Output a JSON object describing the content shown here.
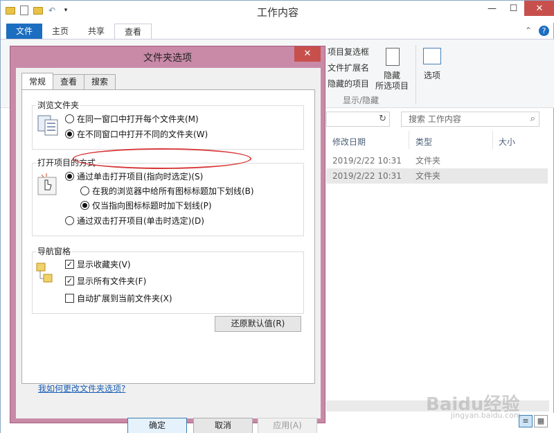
{
  "window": {
    "title": "工作内容",
    "minimize": "—",
    "maximize": "☐",
    "close": "✕"
  },
  "ribbon": {
    "tabs": [
      "文件",
      "主页",
      "共享",
      "查看"
    ],
    "options_label": "选项",
    "hide_label_1": "隐藏",
    "hide_label_2": "所选项目",
    "checkbox_items": [
      "项目复选框",
      "文件扩展名",
      "隐藏的项目"
    ],
    "group_label": "显示/隐藏",
    "help": "?",
    "expand": "⌃"
  },
  "nav": {
    "search_placeholder": "搜索 工作内容",
    "refresh": "↻",
    "search_icon": "⌕"
  },
  "columns": [
    "修改日期",
    "类型",
    "大小"
  ],
  "rows": [
    {
      "date": "2019/2/22 10:31",
      "type": "文件夹"
    },
    {
      "date": "2019/2/22 10:31",
      "type": "文件夹"
    }
  ],
  "dialog": {
    "title": "文件夹选项",
    "close": "✕",
    "tabs": [
      "常规",
      "查看",
      "搜索"
    ],
    "browse": {
      "label": "浏览文件夹",
      "opt1": "在同一窗口中打开每个文件夹(M)",
      "opt2": "在不同窗口中打开不同的文件夹(W)"
    },
    "click": {
      "label": "打开项目的方式",
      "single": "通过单击打开项目(指向时选定)(S)",
      "sub1": "在我的浏览器中给所有图标标题加下划线(B)",
      "sub2": "仅当指向图标标题时加下划线(P)",
      "double": "通过双击打开项目(单击时选定)(D)"
    },
    "navpane": {
      "label": "导航窗格",
      "fav": "显示收藏夹(V)",
      "all": "显示所有文件夹(F)",
      "expand": "自动扩展到当前文件夹(X)"
    },
    "restore": "还原默认值(R)",
    "help_link": "我如何更改文件夹选项?",
    "ok": "确定",
    "cancel": "取消",
    "apply": "应用(A)",
    "check_mark": "✓"
  },
  "watermark": {
    "main": "Baidu经验",
    "sub": "jingyan.baidu.com"
  }
}
